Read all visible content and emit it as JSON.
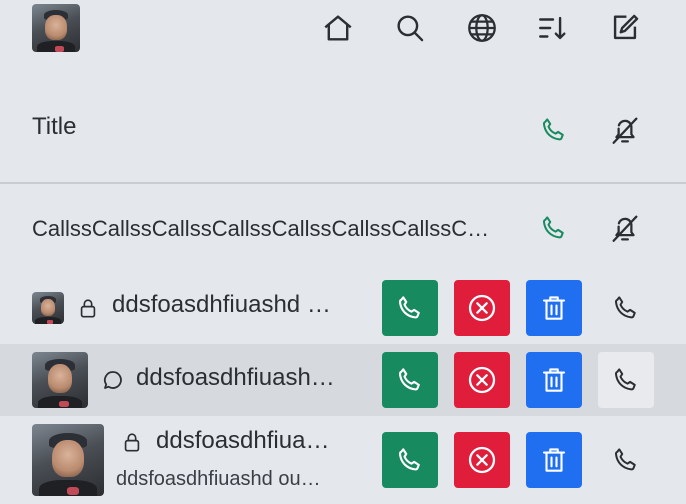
{
  "colors": {
    "accept_green": "#178a5f",
    "decline_red": "#e11d3c",
    "delete_blue": "#1f6ff0",
    "background": "#e4e7eb",
    "selected_row": "#d6d9de",
    "icon_dark": "#2b2f33"
  },
  "toolbar": {
    "icons": [
      "home-icon",
      "search-icon",
      "globe-icon",
      "sort-descending-icon",
      "edit-icon"
    ]
  },
  "header": {
    "title": "Title"
  },
  "call_banner": {
    "text": "CallssCallssCallssCallssCallssCallssCallssC…"
  },
  "rows": [
    {
      "name": "ddsfoasdhfiuashd …",
      "status_icon": "lock-icon",
      "subtitle": ""
    },
    {
      "name": "ddsfoasdhfiuash…",
      "status_icon": "chat-bubble-icon",
      "subtitle": ""
    },
    {
      "name": "ddsfoasdhfiua…",
      "status_icon": "lock-icon",
      "subtitle": "ddsfoasdhfiuashd ou…"
    }
  ]
}
